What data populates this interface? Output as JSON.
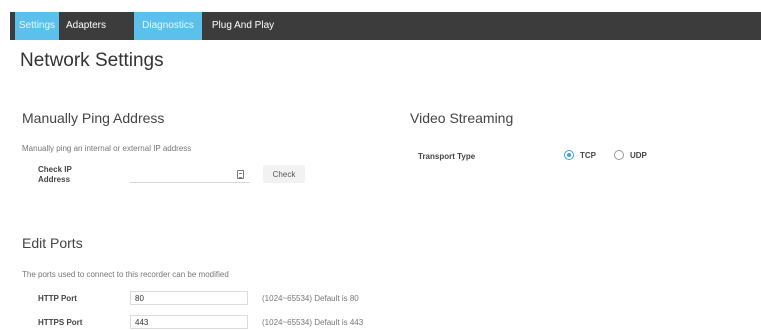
{
  "tabs": [
    {
      "label": "Settings",
      "active": true
    },
    {
      "label": "Adapters",
      "active": false
    },
    {
      "label": "Diagnostics",
      "active": true
    },
    {
      "label": "Plug And Play",
      "active": false
    }
  ],
  "page_title": "Network Settings",
  "ping": {
    "title": "Manually Ping Address",
    "description": "Manually ping an internal or external IP address",
    "check_ip_label_line1": "Check IP",
    "check_ip_label_line2": "Address",
    "ip_value": "",
    "check_button": "Check"
  },
  "ports": {
    "title": "Edit Ports",
    "description": "The ports used to connect to this recorder can be modified",
    "rows": [
      {
        "label": "HTTP Port",
        "value": "80",
        "hint": "(1024~65534) Default is 80"
      },
      {
        "label": "HTTPS Port",
        "value": "443",
        "hint": "(1024~65534) Default is 443"
      }
    ]
  },
  "video": {
    "title": "Video Streaming",
    "transport_label": "Transport Type",
    "options": [
      {
        "label": "TCP",
        "selected": true
      },
      {
        "label": "UDP",
        "selected": false
      }
    ]
  },
  "colors": {
    "accent": "#5bc0eb",
    "topbar": "#3c3c3c",
    "radio_selected": "#3aa6d8"
  }
}
